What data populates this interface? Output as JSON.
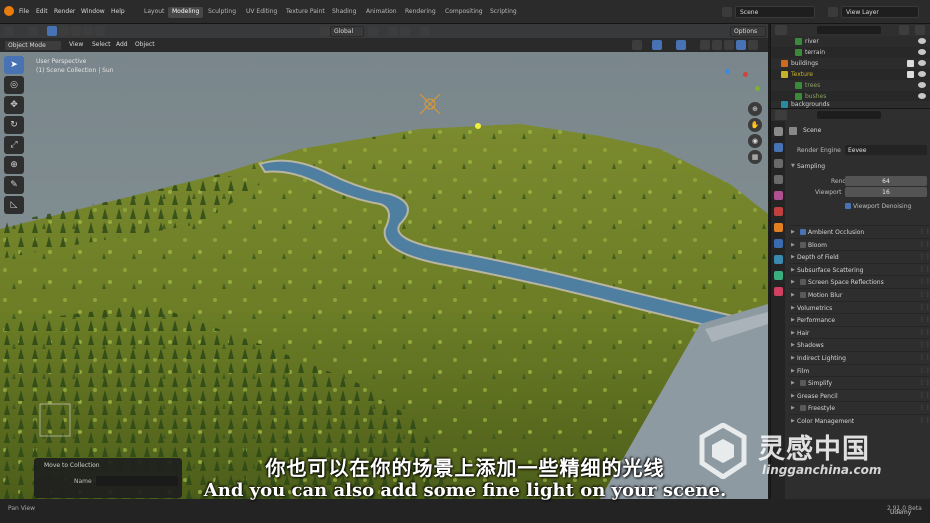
{
  "menu": [
    "File",
    "Edit",
    "Render",
    "Window",
    "Help"
  ],
  "workspaces": [
    "Layout",
    "Modeling",
    "Sculpting",
    "UV Editing",
    "Texture Paint",
    "Shading",
    "Animation",
    "Rendering",
    "Compositing",
    "Scripting"
  ],
  "active_workspace": "Modeling",
  "scene_name": "Scene",
  "view_layer": "View Layer",
  "viewport_header": {
    "mode": "Object Mode",
    "view": "View",
    "select": "Select",
    "add": "Add",
    "object": "Object",
    "transform": "Global",
    "options": "Options"
  },
  "viewport_overlay": {
    "perspective": "User Perspective",
    "collection": "(1) Scene Collection | Sun"
  },
  "tools": [
    "select-tool",
    "cursor-tool",
    "move-tool",
    "rotate-tool",
    "scale-tool",
    "transform-tool",
    "annotate-tool",
    "measure-tool"
  ],
  "outliner": {
    "rows": [
      {
        "name": "river",
        "color": "#3a8a3a"
      },
      {
        "name": "terrain",
        "color": "#3a8a3a"
      },
      {
        "name": "buildings",
        "color": "#d06a20"
      },
      {
        "name": "Texture",
        "color": "#c8b22a"
      },
      {
        "name": "trees",
        "color": "#3a8a3a"
      },
      {
        "name": "bushes",
        "color": "#3a8a3a"
      },
      {
        "name": "backgrounds",
        "color": "#2a8aa0"
      }
    ]
  },
  "properties": {
    "title": "Scene",
    "render_engine_label": "Render Engine",
    "render_engine": "Eevee",
    "sampling": "Sampling",
    "render_label": "Render",
    "render_value": "64",
    "viewport_label": "Viewport",
    "viewport_value": "16",
    "viewport_denoising": "Viewport Denoising",
    "sections": [
      {
        "label": "Ambient Occlusion",
        "checkbox": true,
        "on": true
      },
      {
        "label": "Bloom",
        "checkbox": true,
        "on": false
      },
      {
        "label": "Depth of Field",
        "checkbox": false,
        "on": false
      },
      {
        "label": "Subsurface Scattering",
        "checkbox": false,
        "on": false
      },
      {
        "label": "Screen Space Reflections",
        "checkbox": true,
        "on": false
      },
      {
        "label": "Motion Blur",
        "checkbox": true,
        "on": false
      },
      {
        "label": "Volumetrics",
        "checkbox": false,
        "on": false
      },
      {
        "label": "Performance",
        "checkbox": false,
        "on": false
      },
      {
        "label": "Hair",
        "checkbox": false,
        "on": false
      },
      {
        "label": "Shadows",
        "checkbox": false,
        "on": false
      },
      {
        "label": "Indirect Lighting",
        "checkbox": false,
        "on": false
      },
      {
        "label": "Film",
        "checkbox": false,
        "on": false
      },
      {
        "label": "Simplify",
        "checkbox": true,
        "on": false
      },
      {
        "label": "Grease Pencil",
        "checkbox": false,
        "on": false
      },
      {
        "label": "Freestyle",
        "checkbox": true,
        "on": false
      },
      {
        "label": "Color Management",
        "checkbox": false,
        "on": false
      }
    ]
  },
  "last_operator": {
    "title": "Move to Collection",
    "name_label": "Name"
  },
  "status": {
    "left": "Pan View",
    "version": "2.91.0 Beta"
  },
  "subtitles": {
    "chinese": "你也可以在你的场景上添加一些精细的光线",
    "english": "And you can also add some fine light on your scene."
  },
  "watermark": {
    "chinese": "灵感中国",
    "domain": "lingganchina.com",
    "udemy": "Udemy"
  }
}
